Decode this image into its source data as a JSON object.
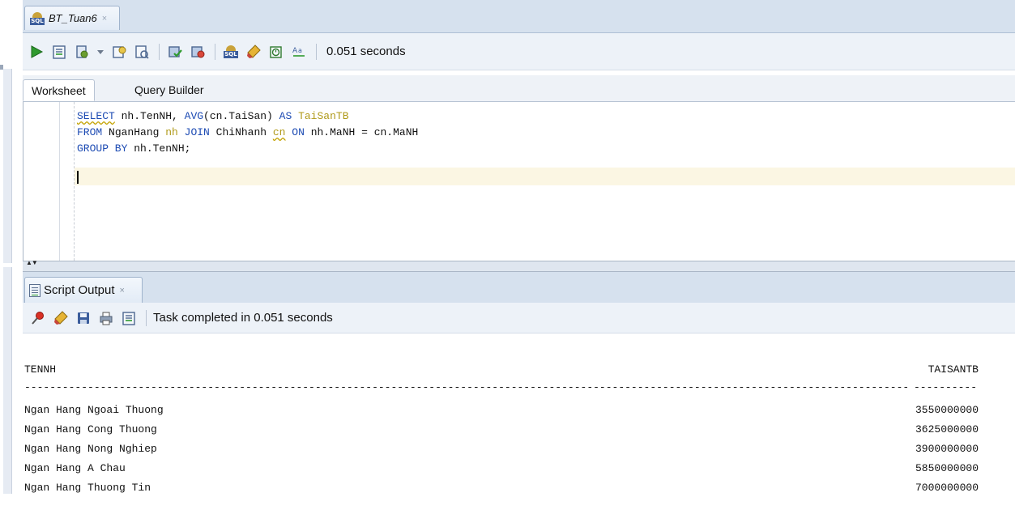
{
  "document": {
    "tab_title": "BT_Tuan6",
    "close_glyph": "×"
  },
  "toolbar": {
    "icons": [
      "run-statement-icon",
      "run-script-icon",
      "commit-icon",
      "dropdown-icon",
      "explain-plan-icon",
      "autotrace-icon",
      "commit-tx-icon",
      "rollback-icon",
      "sql-tuning-icon",
      "clear-icon",
      "history-icon",
      "format-icon"
    ],
    "status": "0.051 seconds"
  },
  "editor_tabs": {
    "worksheet": "Worksheet",
    "query_builder": "Query Builder"
  },
  "editor": {
    "line1": {
      "kw_select": "SELECT",
      "expr1": " nh.TenNH, ",
      "fn_avg": "AVG",
      "expr2": "(cn.TaiSan) ",
      "kw_as": "AS",
      "alias": " TaiSanTB"
    },
    "line2": {
      "kw_from": "FROM",
      "t1": " NganHang ",
      "a1": "nh",
      "kw_join": " JOIN",
      "t2": " ChiNhanh ",
      "a2": "cn",
      "kw_on": " ON",
      "cond": " nh.MaNH = cn.MaNH"
    },
    "line3": {
      "kw_group": "GROUP BY",
      "col": " nh.TenNH;"
    }
  },
  "output_panel": {
    "tab_title": "Script Output",
    "close_glyph": "×",
    "status": "Task completed in 0.051 seconds",
    "columns": [
      "TENNH",
      "TAISANTB"
    ],
    "separator": "--------------------------------------------------------------------------------------------------------------------------------------------------------",
    "separator_right": "----------",
    "rows": [
      [
        "Ngan Hang Ngoai Thuong",
        "3550000000"
      ],
      [
        "Ngan Hang Cong Thuong",
        "3625000000"
      ],
      [
        "Ngan Hang Nong Nghiep",
        "3900000000"
      ],
      [
        "Ngan Hang A Chau",
        "5850000000"
      ],
      [
        "Ngan Hang Thuong Tin",
        "7000000000"
      ]
    ]
  },
  "colors": {
    "keyword": "#1d4bb3",
    "alias": "#b09a1a",
    "current_line": "#fbf6e3",
    "tab_bar": "#d6e1ee"
  }
}
